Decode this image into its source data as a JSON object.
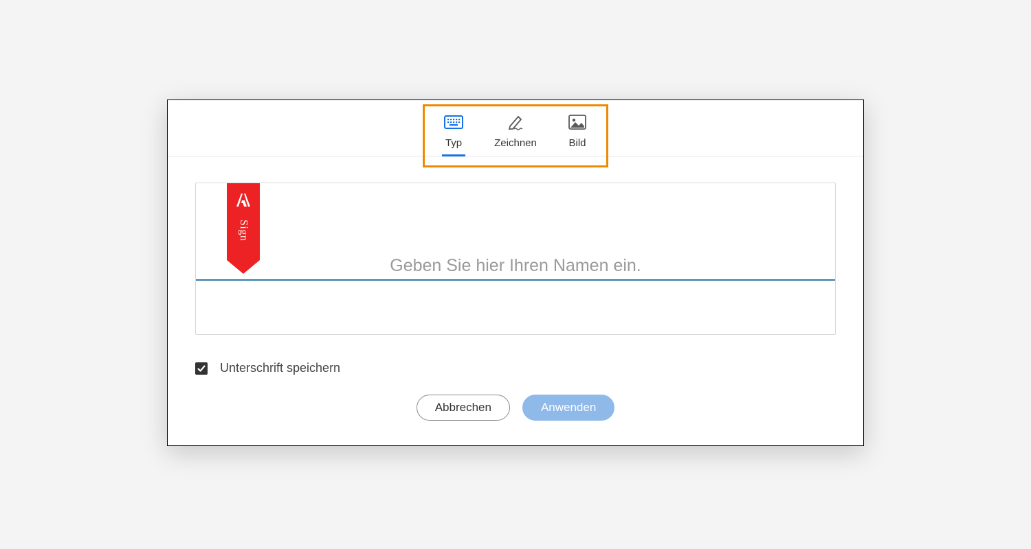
{
  "tabs": {
    "type_label": "Typ",
    "draw_label": "Zeichnen",
    "image_label": "Bild"
  },
  "ribbon": {
    "text": "Sign"
  },
  "signature": {
    "placeholder": "Geben Sie hier Ihren Namen ein.",
    "value": ""
  },
  "save": {
    "checked": true,
    "label": "Unterschrift speichern"
  },
  "buttons": {
    "cancel": "Abbrechen",
    "apply": "Anwenden"
  }
}
